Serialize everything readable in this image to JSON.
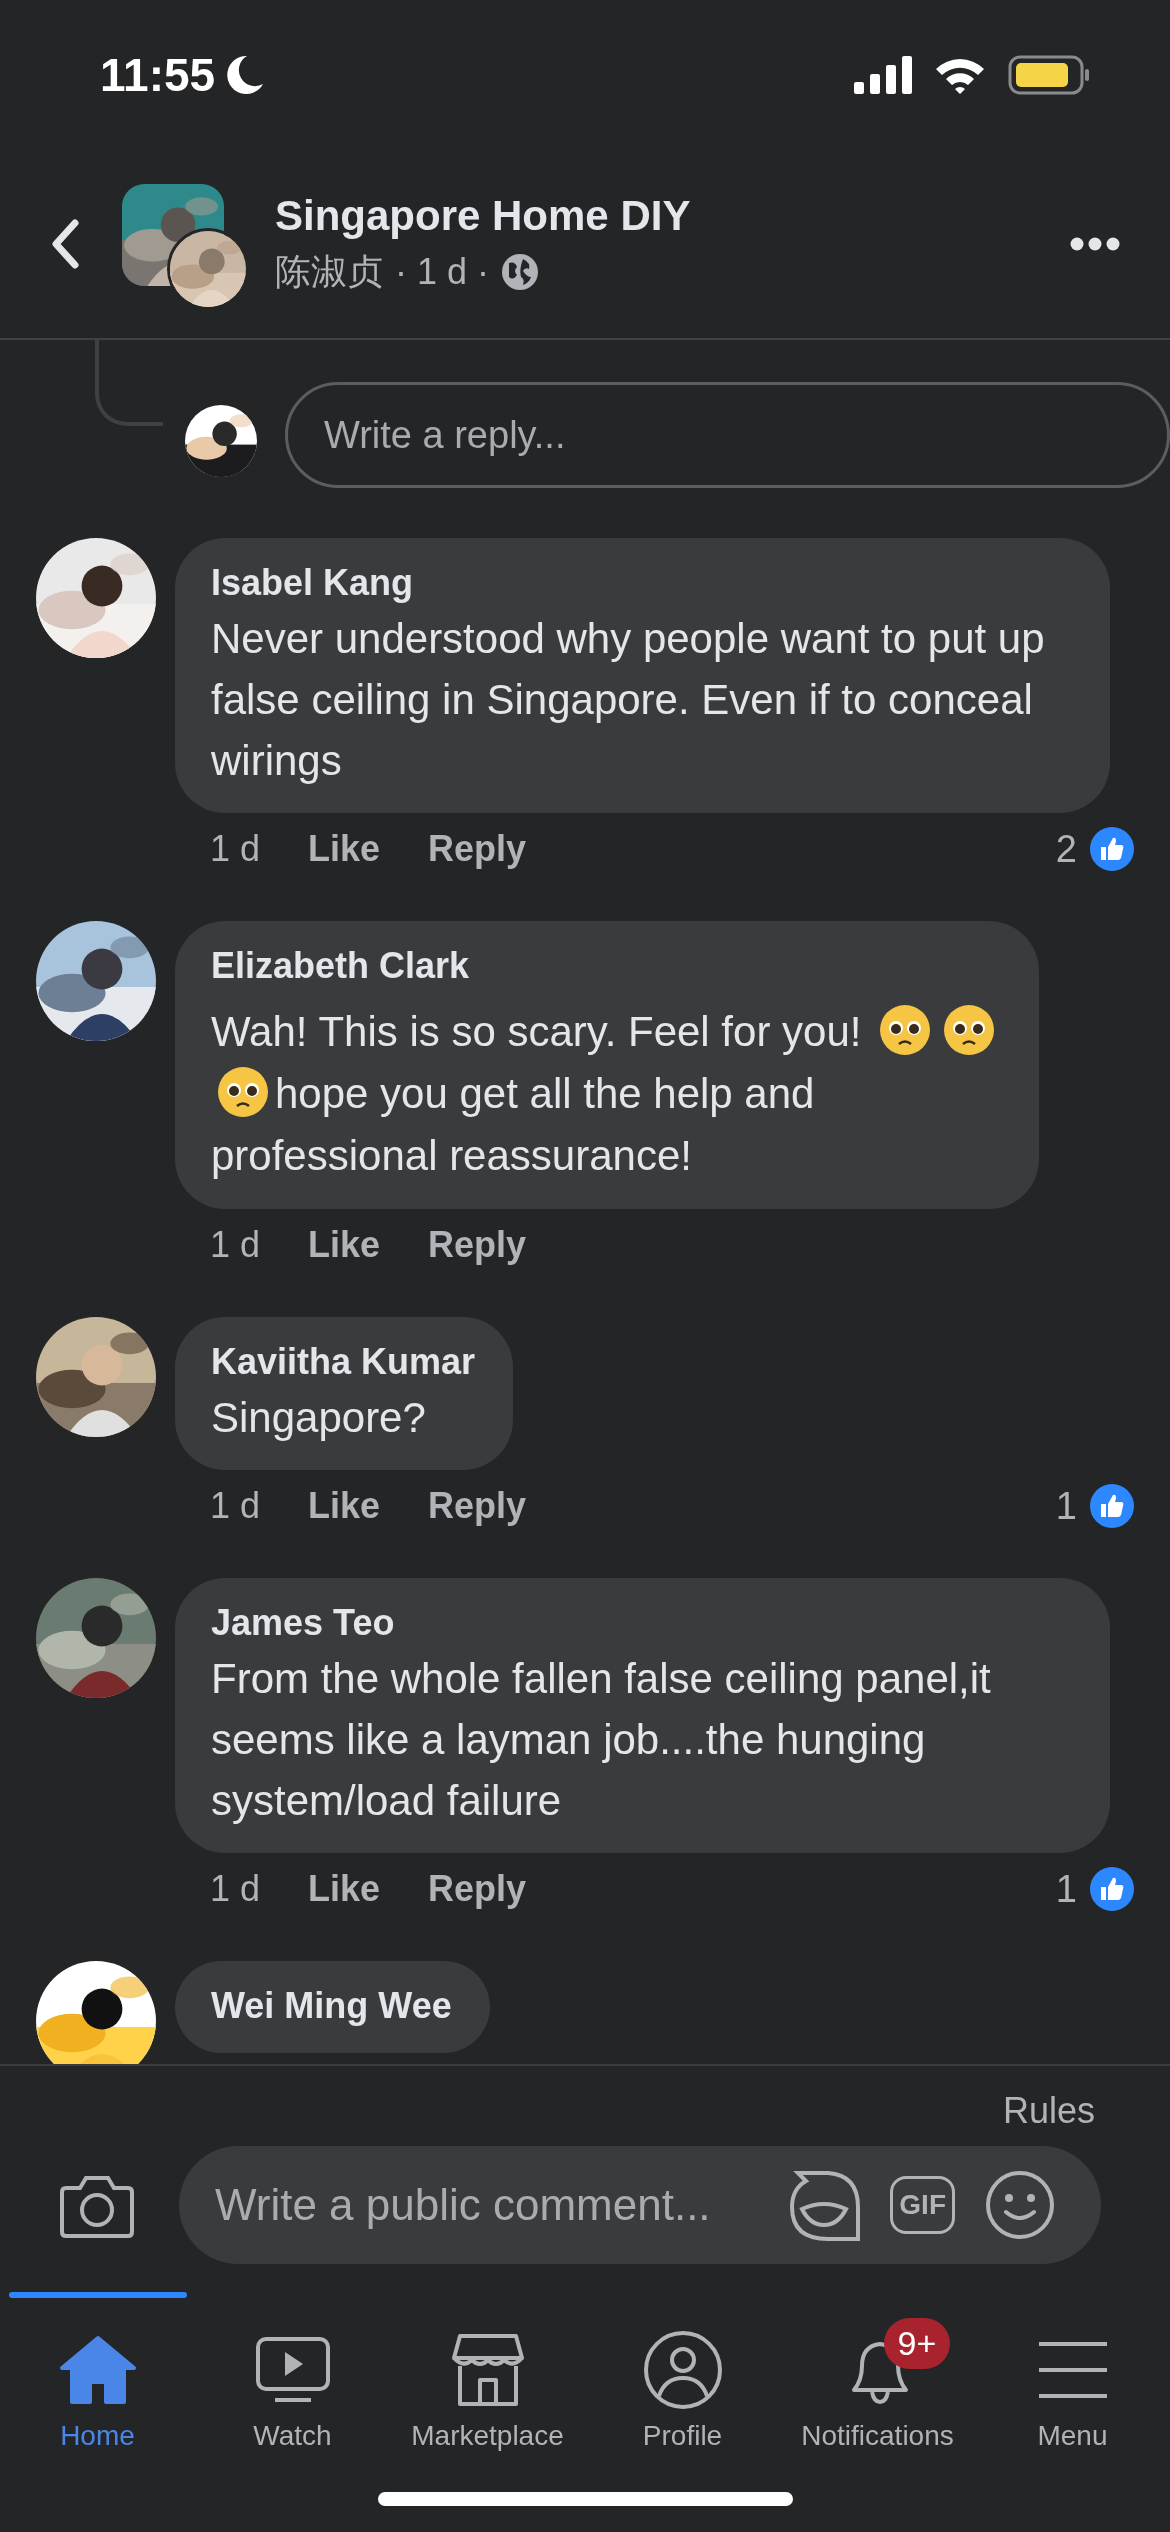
{
  "status_bar": {
    "time": "11:55"
  },
  "header": {
    "title": "Singapore Home DIY",
    "author": "陈淑贞",
    "meta": "· 1 d ·"
  },
  "reply_field": {
    "placeholder": "Write a reply..."
  },
  "comments": [
    {
      "name": "Isabel Kang",
      "body": [
        {
          "kind": "text",
          "text": "Never understood why people want to put up false ceiling in Singapore. Even if to conceal wirings"
        }
      ],
      "time": "1 d",
      "like": "Like",
      "reply": "Reply",
      "likes": "2"
    },
    {
      "name": "Elizabeth Clark",
      "body": [
        {
          "kind": "text",
          "text": "Wah! This is so scary. Feel for you!"
        },
        {
          "kind": "emoji"
        },
        {
          "kind": "emoji"
        },
        {
          "kind": "break"
        },
        {
          "kind": "emoji"
        },
        {
          "kind": "text",
          "text": "hope you get all the help and"
        },
        {
          "kind": "break"
        },
        {
          "kind": "text",
          "text": "professional reassurance!"
        }
      ],
      "time": "1 d",
      "like": "Like",
      "reply": "Reply"
    },
    {
      "name": "Kaviitha Kumar",
      "body": [
        {
          "kind": "text",
          "text": "Singapore?"
        }
      ],
      "time": "1 d",
      "like": "Like",
      "reply": "Reply",
      "likes": "1"
    },
    {
      "name": "James Teo",
      "body": [
        {
          "kind": "text",
          "text": "From the whole fallen false ceiling panel,it seems like a layman job....the hunging system/load failure"
        }
      ],
      "time": "1 d",
      "like": "Like",
      "reply": "Reply",
      "likes": "1"
    },
    {
      "name": "Wei Ming Wee"
    }
  ],
  "composer": {
    "rules": "Rules",
    "placeholder": "Write a public comment...",
    "gif": "GIF"
  },
  "tabs": [
    {
      "label": "Home",
      "selected": true
    },
    {
      "label": "Watch",
      "selected": false
    },
    {
      "label": "Marketplace",
      "selected": false
    },
    {
      "label": "Profile",
      "selected": false
    },
    {
      "label": "Notifications",
      "selected": false,
      "badge": "9+"
    },
    {
      "label": "Menu",
      "selected": false
    }
  ]
}
